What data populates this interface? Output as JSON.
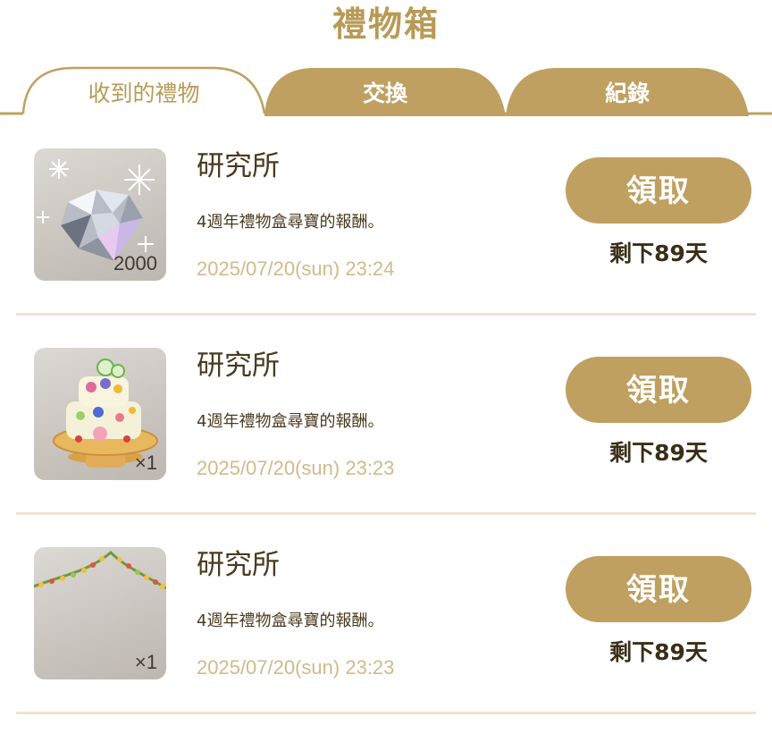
{
  "page": {
    "title": "禮物箱"
  },
  "tabs": [
    {
      "label": "收到的禮物",
      "active": true
    },
    {
      "label": "交換",
      "active": false
    },
    {
      "label": "紀錄",
      "active": false
    }
  ],
  "colors": {
    "accent": "#bfa060",
    "title": "#b89a57",
    "divider": "#ece3d2",
    "date": "#d2b989"
  },
  "gifts": [
    {
      "icon": "diamond-icon",
      "quantity": "2000",
      "sender": "研究所",
      "description": "4週年禮物盒尋寶的報酬。",
      "timestamp": "2025/07/20(sun) 23:24",
      "claim_label": "領取",
      "remaining": "剩下89天"
    },
    {
      "icon": "cake-icon",
      "quantity": "×1",
      "sender": "研究所",
      "description": "4週年禮物盒尋寶的報酬。",
      "timestamp": "2025/07/20(sun) 23:23",
      "claim_label": "領取",
      "remaining": "剩下89天"
    },
    {
      "icon": "garland-icon",
      "quantity": "×1",
      "sender": "研究所",
      "description": "4週年禮物盒尋寶的報酬。",
      "timestamp": "2025/07/20(sun) 23:23",
      "claim_label": "領取",
      "remaining": "剩下89天"
    }
  ]
}
